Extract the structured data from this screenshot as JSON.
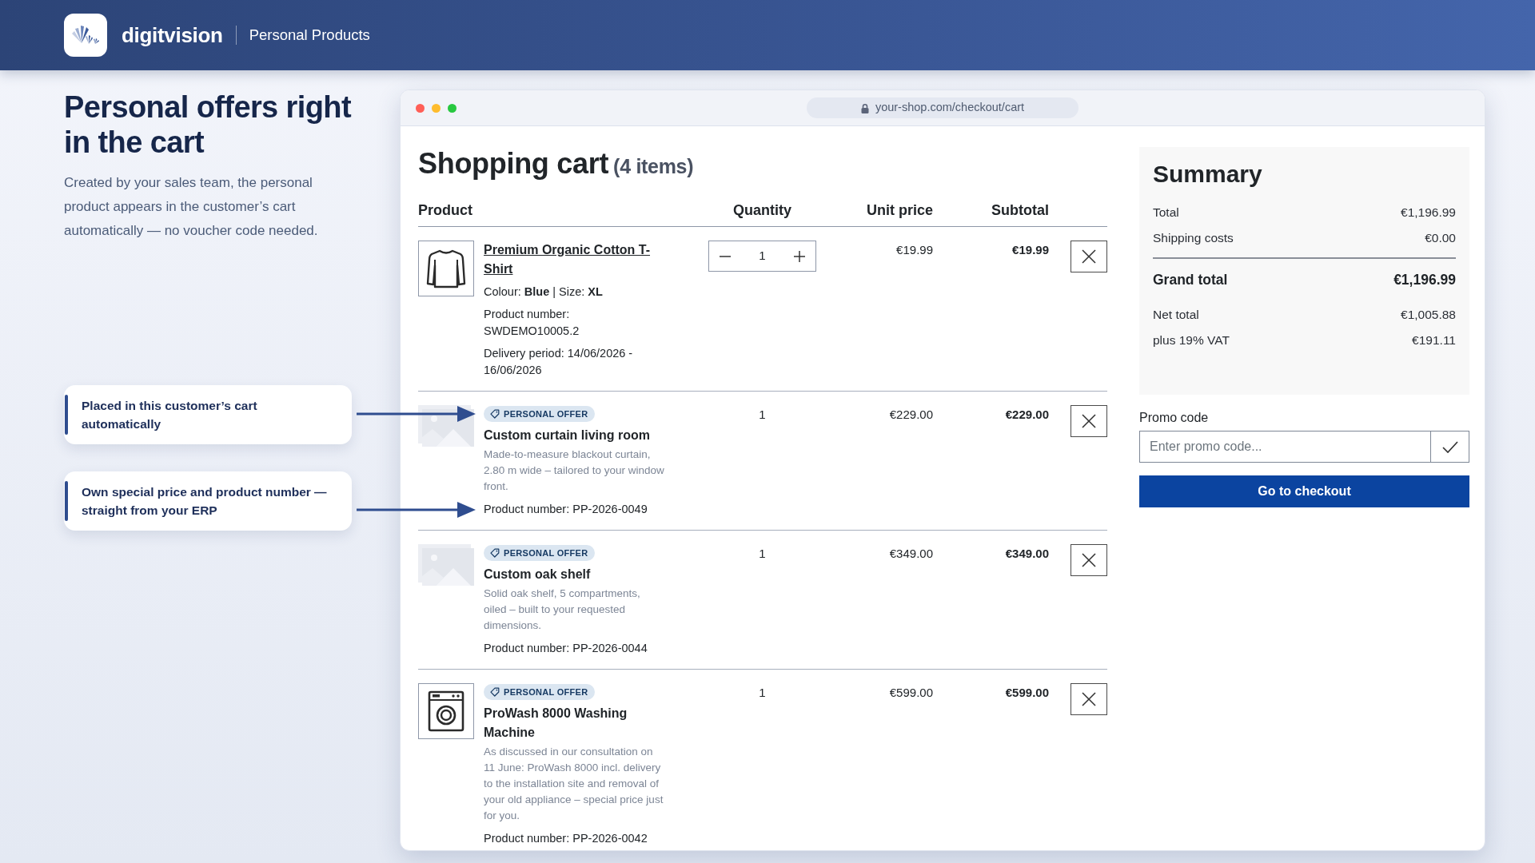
{
  "header": {
    "brand": "digitvision",
    "section": "Personal Products"
  },
  "intro": {
    "heading": "Personal offers right in the cart",
    "text": "Created by your sales team, the personal product appears in the customer’s cart automatically — no voucher code needed."
  },
  "callouts": [
    {
      "text": "Placed in this customer’s cart automatically"
    },
    {
      "text": "Own special price and product number — straight from your ERP"
    }
  ],
  "browser": {
    "url": "your-shop.com/checkout/cart"
  },
  "cart": {
    "title": "Shopping cart",
    "count": "(4 items)",
    "columns": [
      "Product",
      "Quantity",
      "Unit price",
      "Subtotal"
    ],
    "items": [
      {
        "kind": "product",
        "thumbnail": {
          "kind": "shirt"
        },
        "title": "Premium Organic Cotton T-Shirt",
        "options": "Colour: **Blue** | Size: **XL**",
        "product_number": "Product number: SWDEMO10005.2",
        "delivery": "Delivery period: 14/06/2026 - 16/06/2026",
        "quantity": "1",
        "unit_price": "€19.99",
        "subtotal": "€19.99"
      },
      {
        "kind": "offer",
        "thumbnail": {
          "kind": "photo"
        },
        "badge": "PERSONAL OFFER",
        "title": "Custom curtain living room",
        "description": "Made-to-measure blackout curtain, 2.80 m wide – tailored to your window front.",
        "product_number": "Product number: PP-2026-0049",
        "quantity": "1",
        "unit_price": "€229.00",
        "subtotal": "€229.00"
      },
      {
        "kind": "offer",
        "thumbnail": {
          "kind": "photo"
        },
        "badge": "PERSONAL OFFER",
        "title": "Custom oak shelf",
        "description": "Solid oak shelf, 5 compartments, oiled – built to your requested dimensions.",
        "product_number": "Product number: PP-2026-0044",
        "quantity": "1",
        "unit_price": "€349.00",
        "subtotal": "€349.00"
      },
      {
        "kind": "offer",
        "thumbnail": {
          "kind": "washer"
        },
        "badge": "PERSONAL OFFER",
        "title": "ProWash 8000 Washing Machine",
        "description": "As discussed in our consultation on 11 June: ProWash 8000 incl. delivery to the installation site and removal of your old appliance – special price just for you.",
        "product_number": "Product number: PP-2026-0042",
        "quantity": "1",
        "unit_price": "€599.00",
        "subtotal": "€599.00"
      }
    ]
  },
  "summary": {
    "title": "Summary",
    "rows": [
      {
        "label": "Total",
        "value": "€1,196.99"
      },
      {
        "label": "Shipping costs",
        "value": "€0.00"
      }
    ],
    "grand_total": {
      "label": "Grand total",
      "value": "€1,196.99"
    },
    "tax_rows": [
      {
        "label": "Net total",
        "value": "€1,005.88"
      },
      {
        "label": "plus 19% VAT",
        "value": "€191.11"
      }
    ]
  },
  "promo": {
    "label": "Promo code",
    "placeholder": "Enter promo code..."
  },
  "checkout_button": "Go to checkout"
}
